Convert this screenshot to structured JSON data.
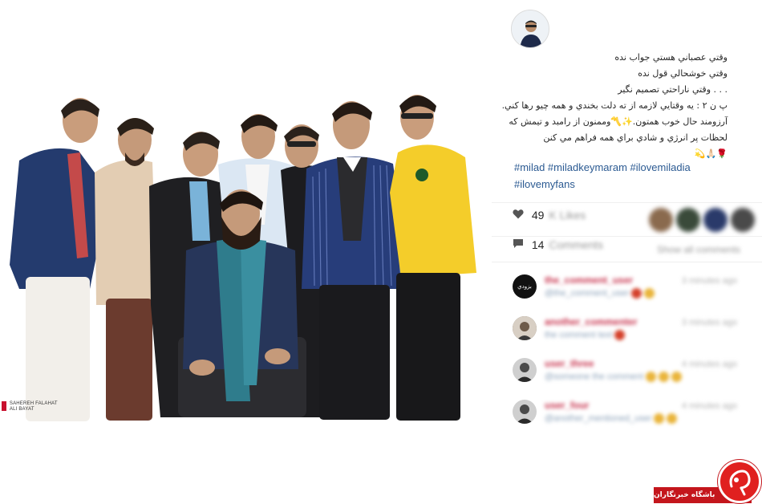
{
  "post": {
    "photo_credit_line1": "SAHEREH FALAHAT",
    "photo_credit_line2": "ALI BAYAT"
  },
  "caption": {
    "lines": [
      "وقتي عصباني هستي جواب نده",
      "وقتي خوشحالي قول نده",
      ". . . وقتي ناراحتي تصميم نگير",
      "پ ن ۲ : يه وقتايي لازمه از ته دلت بخندي و همه چيو رها کني. آرزومند حال خوب همتون.✨〽️وممنون از رامبد و تيمش که لحظات پر انرژي و شادي براي همه فراهم مي کنن",
      "🌹🙏🏻💫"
    ],
    "hashtags": [
      "#milad",
      "#miladkeymaram",
      "#ilovemiladia",
      "#ilovemyfans"
    ]
  },
  "stats": {
    "likes_count": "49",
    "likes_label": "K Likes",
    "comments_count": "14",
    "comments_label": "Comments",
    "show_all_label": "Show all comments"
  },
  "comments": [
    {
      "avatar_text": "بزودي",
      "username": "the_comment_user",
      "text": "@the_comment_user",
      "time": "3 minutes ago"
    },
    {
      "avatar_text": "",
      "username": "another_commenter",
      "text": "the comment text",
      "time": "3 minutes ago"
    },
    {
      "avatar_text": "",
      "username": "user_three",
      "text": "@someone the comment",
      "time": "4 minutes ago"
    },
    {
      "avatar_text": "",
      "username": "user_four",
      "text": "@another_mentioned_user",
      "time": "4 minutes ago"
    }
  ],
  "watermark": {
    "text": "باشگاه خبرنگاران"
  },
  "colors": {
    "hashtag": "#2b5a92",
    "watermark_red": "#c4161c"
  },
  "icons": {
    "likes": "heart-icon",
    "comments": "comment-bubble-icon"
  }
}
